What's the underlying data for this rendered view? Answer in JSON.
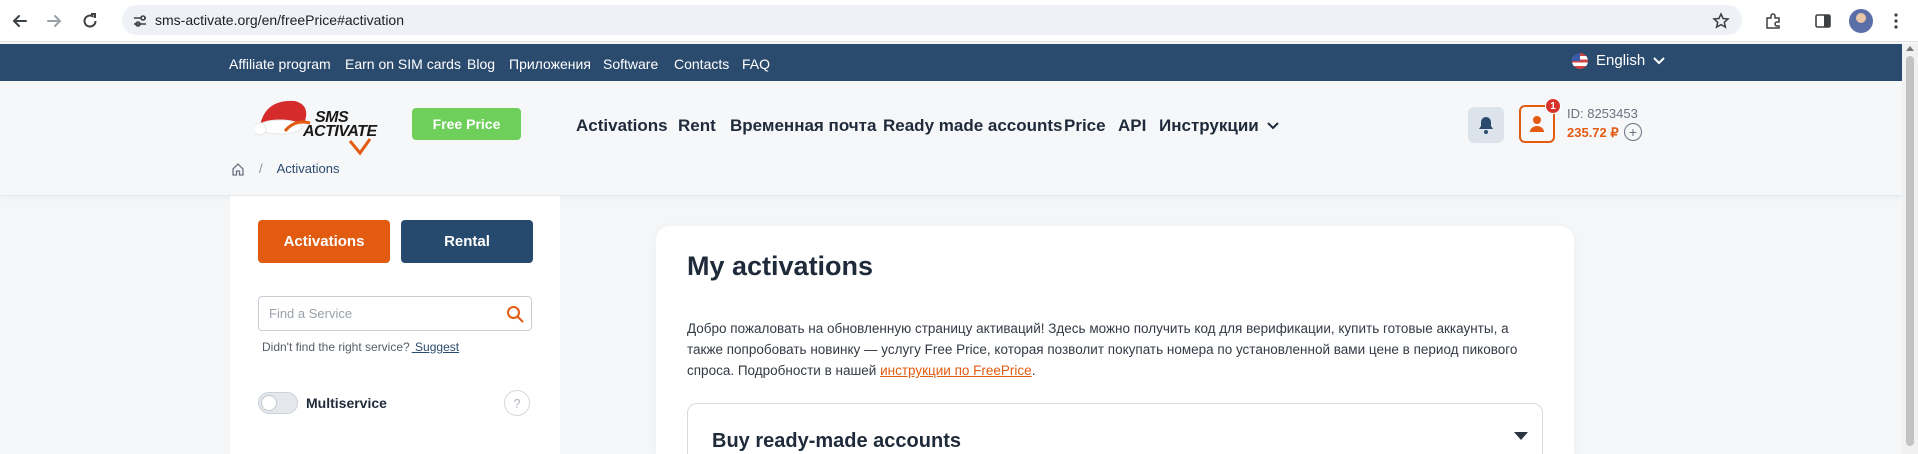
{
  "browser": {
    "url": "sms-activate.org/en/freePrice#activation",
    "icons": [
      "back-arrow-icon",
      "forward-arrow-icon",
      "reload-icon",
      "site-settings-icon",
      "star-icon",
      "extensions-icon",
      "side-panel-icon",
      "profile-avatar",
      "more-menu-icon"
    ]
  },
  "topnav": {
    "links": [
      "Affiliate program",
      "Earn on SIM cards",
      "Blog",
      "Приложения",
      "Software",
      "Contacts",
      "FAQ"
    ],
    "language": "English"
  },
  "header": {
    "logo_text_line1": "SMS",
    "logo_text_line2": "ACTIVATE",
    "free_price_label": "Free Price",
    "nav": [
      "Activations",
      "Rent",
      "Временная почта",
      "Ready made accounts",
      "Price",
      "API",
      "Инструкции"
    ],
    "notification_count": "1",
    "user_id": "ID: 8253453",
    "balance": "235.72 ₽",
    "add_balance": "+"
  },
  "breadcrumb": {
    "current": "Activations",
    "separator": "/"
  },
  "sidebar": {
    "activations_label": "Activations",
    "rental_label": "Rental",
    "search_placeholder": "Find a Service",
    "hint_text": "Didn't find the right service?",
    "suggest_label": " Suggest",
    "multiservice_label": "Multiservice",
    "multiservice_enabled": false,
    "help_label": "?"
  },
  "main": {
    "title": "My activations",
    "description": "Добро пожаловать на обновленную страницу активаций! Здесь можно получить код для верификации, купить готовые аккаунты, а также попробовать новинку — услугу Free Price, которая позволит покупать номера по установленной вами цене в период пикового спроса. Подробности в нашей ",
    "description_link": "инструкции по FreePrice",
    "description_end": ".",
    "accordion_title": "Buy ready-made accounts"
  },
  "colors": {
    "topnav_bg": "#2b4b6e",
    "accent_orange": "#e25b11",
    "free_price_green": "#6ed05a",
    "rental_blue": "#264a6d"
  }
}
